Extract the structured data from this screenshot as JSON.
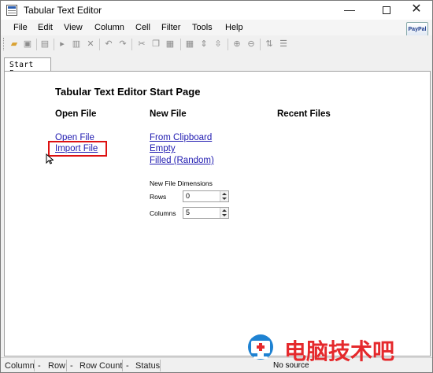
{
  "window": {
    "title": "Tabular Text Editor"
  },
  "menu": {
    "items": [
      "File",
      "Edit",
      "View",
      "Column",
      "Cell",
      "Filter",
      "Tools",
      "Help"
    ],
    "paypal": "PayPal"
  },
  "toolbar": {
    "icons": [
      "open-folder-icon",
      "save-icon",
      "edit-icon",
      "insert-column-icon",
      "add-column-icon",
      "delete-icon",
      "undo-icon",
      "redo-icon",
      "cut-icon",
      "copy-icon",
      "paste-icon",
      "table-icon",
      "split-icon",
      "merge-icon",
      "zoom-in-icon",
      "zoom-out-icon",
      "sort-icon",
      "filter-sort-icon"
    ]
  },
  "tabs": {
    "start": "Start Page"
  },
  "start_page": {
    "title": "Tabular Text Editor Start Page",
    "open_file": {
      "heading": "Open File",
      "open_link": "Open File",
      "import_link": "Import File"
    },
    "new_file": {
      "heading": "New File",
      "clipboard_link": "From Clipboard",
      "empty_link": "Empty",
      "filled_link": "Filled (Random)"
    },
    "recent": {
      "heading": "Recent Files"
    },
    "dimensions": {
      "heading": "New File Dimensions",
      "rows_label": "Rows",
      "rows_value": "0",
      "columns_label": "Columns",
      "columns_value": "5"
    }
  },
  "status": {
    "column_label": "Column",
    "column_value": "-",
    "row_label": "Row",
    "row_value": "-",
    "rowcount_label": "Row Count",
    "rowcount_value": "-",
    "status_label": "Status",
    "source": "No source"
  },
  "watermark": {
    "text": "电脑技术吧",
    "color": "#e5292c"
  }
}
